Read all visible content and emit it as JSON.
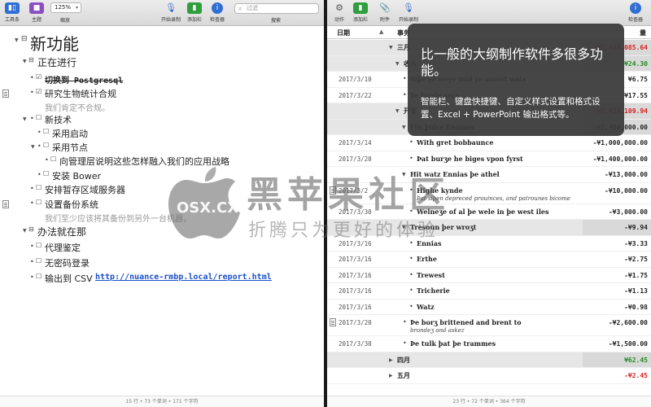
{
  "left_toolbar": {
    "tool_label": "工具条",
    "theme_label": "主题",
    "zoom_value": "125%",
    "zoom_label": "缩放",
    "record_label": "开始录制",
    "add_column_label": "添加栏",
    "inspector_label": "检查器",
    "search_placeholder": "过滤",
    "search_label": "搜索"
  },
  "outline": {
    "title": "新功能",
    "section1": "正在进行",
    "item_postgres": "切换到 Postgresql",
    "item_biostats": "研究生物统计合规",
    "note_biostats": "我们肯定不合规。",
    "item_newtech": "新技术",
    "item_startup": "采用启动",
    "item_nodes": "采用节点",
    "item_explain": "向管理层说明这些怎样融入我们的应用战略",
    "item_bower": "安装 Bower",
    "item_region": "安排暂存区域服务器",
    "item_backup": "设置备份系统",
    "note_backup": "我们至少应该将其备份到另外一台机器，",
    "section2": "办法就在那",
    "item_proxy": "代理鉴定",
    "item_nopass": "无密码登录",
    "item_csv": "输出到 CSV",
    "csv_link": "http://nuance-rmbp.local/report.html"
  },
  "left_status": "15 行 • 73 个单词 • 171 个字符",
  "right_toolbar": {
    "action_label": "动作",
    "add_column_label": "添加栏",
    "attach_label": "附件",
    "record_label": "开始录制",
    "inspector_label": "检查器"
  },
  "table": {
    "col_date": "日期",
    "col_event": "事务",
    "col_amount": "量",
    "rows": [
      {
        "date": "",
        "event": "三月",
        "amount": "-¥2,433,085.64",
        "amount_color": "red",
        "gray": true
      },
      {
        "date": "",
        "event": "收入",
        "amount": "¥24.30",
        "amount_color": "green",
        "gray": true
      },
      {
        "date": "2017/3/10",
        "event": "Siþe ye weye mid ye assort wats",
        "amount": "¥6.75",
        "amount_color": "",
        "gray": false
      },
      {
        "date": "2017/3/22",
        "event": "Ye brode ssyp",
        "amount": "¥17.55",
        "amount_color": "",
        "gray": false
      },
      {
        "date": "",
        "event": "开支",
        "amount": "-¥2,433,109.94",
        "amount_color": "red",
        "gray": true
      },
      {
        "date": "",
        "event": "Fro þiðre Ennises",
        "amount": "-¥2,400,000.00",
        "amount_color": "",
        "gray": true
      },
      {
        "date": "2017/3/14",
        "event": "With gret bobbaunce",
        "amount": "-¥1,000,000.00",
        "amount_color": "",
        "gray": false
      },
      {
        "date": "2017/3/20",
        "event": "Þat burʒe he biges vpon fyrst",
        "amount": "-¥1,400,000.00",
        "amount_color": "",
        "gray": false
      },
      {
        "date": "",
        "event": "Hit watz Ennias þe athel",
        "amount": "-¥13,000.00",
        "amount_color": "",
        "gray": false
      },
      {
        "date": "2017/3/2",
        "event": "Highe kynde",
        "note": "Þat siþen depreced prouinces, and patrounes bicome",
        "amount": "-¥10,000.00",
        "amount_color": "",
        "gray": false
      },
      {
        "date": "2017/3/30",
        "event": "Welneʒe of al þe wele in þe west iles",
        "amount": "-¥3,000.00",
        "amount_color": "",
        "gray": false
      },
      {
        "date": "",
        "event": "Tresoun þer wroʒt",
        "amount": "-¥9.94",
        "amount_color": "",
        "gray": true
      },
      {
        "date": "2017/3/16",
        "event": "Ennias",
        "amount": "-¥3.33",
        "amount_color": "",
        "gray": false
      },
      {
        "date": "2017/3/16",
        "event": "Erthe",
        "amount": "-¥2.75",
        "amount_color": "",
        "gray": false
      },
      {
        "date": "2017/3/16",
        "event": "Trewest",
        "amount": "-¥1.75",
        "amount_color": "",
        "gray": false
      },
      {
        "date": "2017/3/16",
        "event": "Tricherie",
        "amount": "-¥1.13",
        "amount_color": "",
        "gray": false
      },
      {
        "date": "2017/3/16",
        "event": "Watz",
        "amount": "-¥0.98",
        "amount_color": "",
        "gray": false
      },
      {
        "date": "2017/3/20",
        "event": "Þe borʒ brittened and brent to",
        "note": "brondeʒ and askez",
        "amount": "-¥2,600.00",
        "amount_color": "",
        "gray": false
      },
      {
        "date": "2017/3/30",
        "event": "Þe tulk þat þe trammes",
        "amount": "-¥1,500.00",
        "amount_color": "",
        "gray": false
      },
      {
        "date": "",
        "event": "四月",
        "amount": "¥62.45",
        "amount_color": "green",
        "gray": true
      },
      {
        "date": "",
        "event": "五月",
        "amount": "-¥2.45",
        "amount_color": "red",
        "gray": false
      }
    ]
  },
  "right_status": "23 行 • 72 个单词 • 364 个字符",
  "overlay": {
    "title": "比一般的大纲制作软件多很多功能。",
    "body": "智能栏、键盘快捷键、自定义样式设置和格式设置、Excel + PowerPoint 输出格式等。"
  },
  "watermark": {
    "brand_cn": "黑苹果社区",
    "brand_en": "OSX.CX",
    "slogan": "折腾只为更好的体验"
  },
  "colors": {
    "accent_blue": "#1a4fc9",
    "negative_red": "#d81e1e",
    "positive_green": "#1f8a1f"
  }
}
